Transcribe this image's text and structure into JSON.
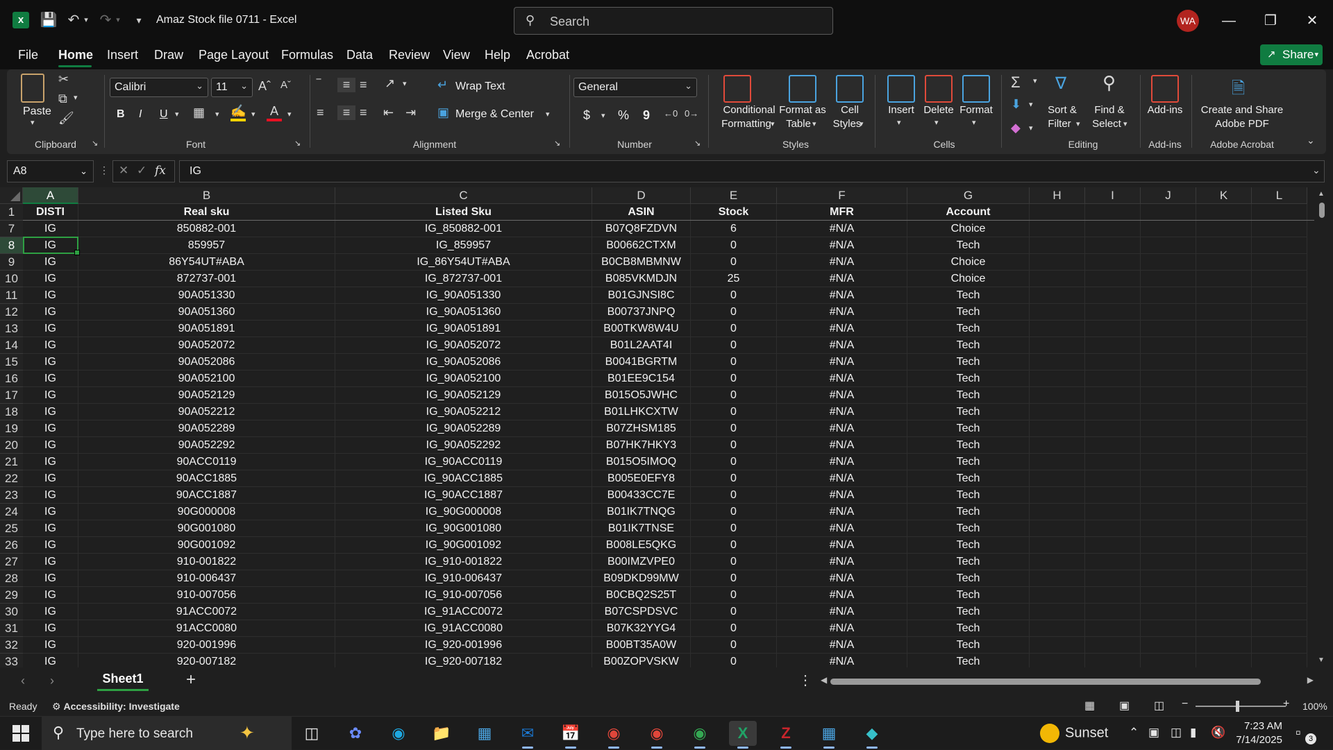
{
  "titlebar": {
    "app_icon": "excel-logo",
    "title": "Amaz Stock file 0711  -  Excel",
    "search_placeholder": "Search",
    "avatar_initials": "WA"
  },
  "menu": {
    "tabs": [
      "File",
      "Home",
      "Insert",
      "Draw",
      "Page Layout",
      "Formulas",
      "Data",
      "Review",
      "View",
      "Help",
      "Acrobat"
    ],
    "active_tab": "Home",
    "share_label": "Share",
    "accent_color": "#107c41"
  },
  "ribbon": {
    "clipboard": {
      "paste": "Paste",
      "group": "Clipboard"
    },
    "font": {
      "name": "Calibri",
      "size": "11",
      "group": "Font",
      "bold": "B",
      "italic": "I",
      "underline": "U"
    },
    "alignment": {
      "wrap": "Wrap Text",
      "merge": "Merge & Center",
      "group": "Alignment"
    },
    "number": {
      "format": "General",
      "group": "Number",
      "currency": "$",
      "percent": "%",
      "comma": "9"
    },
    "styles": {
      "conditional": "Conditional Formatting",
      "conditional_l1": "Conditional",
      "conditional_l2": "Formatting",
      "format_table_l1": "Format as",
      "format_table_l2": "Table",
      "cell_styles_l1": "Cell",
      "cell_styles_l2": "Styles",
      "group": "Styles"
    },
    "cells": {
      "insert": "Insert",
      "delete": "Delete",
      "format": "Format",
      "group": "Cells"
    },
    "editing": {
      "sort_l1": "Sort &",
      "sort_l2": "Filter",
      "find_l1": "Find &",
      "find_l2": "Select",
      "group": "Editing"
    },
    "addins": {
      "label": "Add-ins",
      "group": "Add-ins"
    },
    "acrobat": {
      "l1": "Create and Share",
      "l2": "Adobe PDF",
      "group": "Adobe Acrobat"
    }
  },
  "formula_bar": {
    "name_box": "A8",
    "fx": "fx",
    "value": "IG"
  },
  "columns": [
    "A",
    "B",
    "C",
    "D",
    "E",
    "F",
    "G",
    "H",
    "I",
    "J",
    "K",
    "L"
  ],
  "header_row": {
    "num": "1",
    "cells": [
      "DISTI",
      "Real sku",
      "Listed Sku",
      "ASIN",
      "Stock",
      "MFR",
      "Account"
    ]
  },
  "rows": [
    {
      "num": "7",
      "cells": [
        "IG",
        "850882-001",
        "IG_850882-001",
        "B07Q8FZDVN",
        "6",
        "#N/A",
        "Choice"
      ]
    },
    {
      "num": "8",
      "cells": [
        "IG",
        "859957",
        "IG_859957",
        "B00662CTXM",
        "0",
        "#N/A",
        "Tech"
      ]
    },
    {
      "num": "9",
      "cells": [
        "IG",
        "86Y54UT#ABA",
        "IG_86Y54UT#ABA",
        "B0CB8MBMNW",
        "0",
        "#N/A",
        "Choice"
      ]
    },
    {
      "num": "10",
      "cells": [
        "IG",
        "872737-001",
        "IG_872737-001",
        "B085VKMDJN",
        "25",
        "#N/A",
        "Choice"
      ]
    },
    {
      "num": "11",
      "cells": [
        "IG",
        "90A051330",
        "IG_90A051330",
        "B01GJNSI8C",
        "0",
        "#N/A",
        "Tech"
      ]
    },
    {
      "num": "12",
      "cells": [
        "IG",
        "90A051360",
        "IG_90A051360",
        "B00737JNPQ",
        "0",
        "#N/A",
        "Tech"
      ]
    },
    {
      "num": "13",
      "cells": [
        "IG",
        "90A051891",
        "IG_90A051891",
        "B00TKW8W4U",
        "0",
        "#N/A",
        "Tech"
      ]
    },
    {
      "num": "14",
      "cells": [
        "IG",
        "90A052072",
        "IG_90A052072",
        "B01L2AAT4I",
        "0",
        "#N/A",
        "Tech"
      ]
    },
    {
      "num": "15",
      "cells": [
        "IG",
        "90A052086",
        "IG_90A052086",
        "B0041BGRTM",
        "0",
        "#N/A",
        "Tech"
      ]
    },
    {
      "num": "16",
      "cells": [
        "IG",
        "90A052100",
        "IG_90A052100",
        "B01EE9C154",
        "0",
        "#N/A",
        "Tech"
      ]
    },
    {
      "num": "17",
      "cells": [
        "IG",
        "90A052129",
        "IG_90A052129",
        "B015O5JWHC",
        "0",
        "#N/A",
        "Tech"
      ]
    },
    {
      "num": "18",
      "cells": [
        "IG",
        "90A052212",
        "IG_90A052212",
        "B01LHKCXTW",
        "0",
        "#N/A",
        "Tech"
      ]
    },
    {
      "num": "19",
      "cells": [
        "IG",
        "90A052289",
        "IG_90A052289",
        "B07ZHSM185",
        "0",
        "#N/A",
        "Tech"
      ]
    },
    {
      "num": "20",
      "cells": [
        "IG",
        "90A052292",
        "IG_90A052292",
        "B07HK7HKY3",
        "0",
        "#N/A",
        "Tech"
      ]
    },
    {
      "num": "21",
      "cells": [
        "IG",
        "90ACC0119",
        "IG_90ACC0119",
        "B015O5IMOQ",
        "0",
        "#N/A",
        "Tech"
      ]
    },
    {
      "num": "22",
      "cells": [
        "IG",
        "90ACC1885",
        "IG_90ACC1885",
        "B005E0EFY8",
        "0",
        "#N/A",
        "Tech"
      ]
    },
    {
      "num": "23",
      "cells": [
        "IG",
        "90ACC1887",
        "IG_90ACC1887",
        "B00433CC7E",
        "0",
        "#N/A",
        "Tech"
      ]
    },
    {
      "num": "24",
      "cells": [
        "IG",
        "90G000008",
        "IG_90G000008",
        "B01IK7TNQG",
        "0",
        "#N/A",
        "Tech"
      ]
    },
    {
      "num": "25",
      "cells": [
        "IG",
        "90G001080",
        "IG_90G001080",
        "B01IK7TNSE",
        "0",
        "#N/A",
        "Tech"
      ]
    },
    {
      "num": "26",
      "cells": [
        "IG",
        "90G001092",
        "IG_90G001092",
        "B008LE5QKG",
        "0",
        "#N/A",
        "Tech"
      ]
    },
    {
      "num": "27",
      "cells": [
        "IG",
        "910-001822",
        "IG_910-001822",
        "B00IMZVPE0",
        "0",
        "#N/A",
        "Tech"
      ]
    },
    {
      "num": "28",
      "cells": [
        "IG",
        "910-006437",
        "IG_910-006437",
        "B09DKD99MW",
        "0",
        "#N/A",
        "Tech"
      ]
    },
    {
      "num": "29",
      "cells": [
        "IG",
        "910-007056",
        "IG_910-007056",
        "B0CBQ2S25T",
        "0",
        "#N/A",
        "Tech"
      ]
    },
    {
      "num": "30",
      "cells": [
        "IG",
        "91ACC0072",
        "IG_91ACC0072",
        "B07CSPDSVC",
        "0",
        "#N/A",
        "Tech"
      ]
    },
    {
      "num": "31",
      "cells": [
        "IG",
        "91ACC0080",
        "IG_91ACC0080",
        "B07K32YYG4",
        "0",
        "#N/A",
        "Tech"
      ]
    },
    {
      "num": "32",
      "cells": [
        "IG",
        "920-001996",
        "IG_920-001996",
        "B00BT35A0W",
        "0",
        "#N/A",
        "Tech"
      ]
    },
    {
      "num": "33",
      "cells": [
        "IG",
        "920-007182",
        "IG_920-007182",
        "B00ZOPVSKW",
        "0",
        "#N/A",
        "Tech"
      ]
    }
  ],
  "sheet_tabs": {
    "active": "Sheet1",
    "add": "+"
  },
  "status": {
    "ready": "Ready",
    "accessibility": "Accessibility: Investigate",
    "zoom": "100%"
  },
  "taskbar": {
    "search_placeholder": "Type here to search",
    "weather": "Sunset",
    "time": "7:23 AM",
    "date": "7/14/2025",
    "notifications": "3"
  }
}
